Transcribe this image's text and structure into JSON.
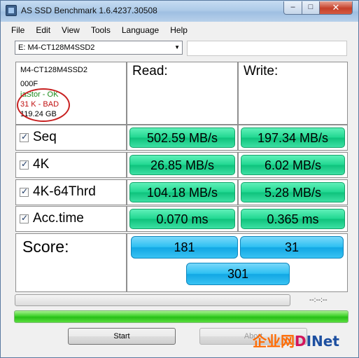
{
  "window": {
    "title": "AS SSD Benchmark 1.6.4237.30508"
  },
  "menu": [
    "File",
    "Edit",
    "View",
    "Tools",
    "Language",
    "Help"
  ],
  "drive": {
    "selected": "E: M4-CT128M4SSD2"
  },
  "info": {
    "model": "M4-CT128M4SSD2",
    "firmware": "000F",
    "driver": "iaStor - OK",
    "alignment": "31 K - BAD",
    "size": "119.24 GB"
  },
  "headers": {
    "read": "Read:",
    "write": "Write:"
  },
  "tests": [
    {
      "label": "Seq",
      "read": "502.59 MB/s",
      "write": "197.34 MB/s"
    },
    {
      "label": "4K",
      "read": "26.85 MB/s",
      "write": "6.02 MB/s"
    },
    {
      "label": "4K-64Thrd",
      "read": "104.18 MB/s",
      "write": "5.28 MB/s"
    },
    {
      "label": "Acc.time",
      "read": "0.070 ms",
      "write": "0.365 ms"
    }
  ],
  "score": {
    "label": "Score:",
    "read": "181",
    "write": "31",
    "total": "301"
  },
  "progress": {
    "time": "--:--:--",
    "completion_fraction": 1.0
  },
  "buttons": {
    "start": "Start",
    "abort": "Abort"
  },
  "watermark": {
    "cn": "企业网",
    "di": "D",
    "net": "INet"
  },
  "colors": {
    "result_green": "#22d892",
    "score_blue": "#2ec0f2",
    "bad_red": "#c01010",
    "ok_green": "#1a8a1a"
  }
}
